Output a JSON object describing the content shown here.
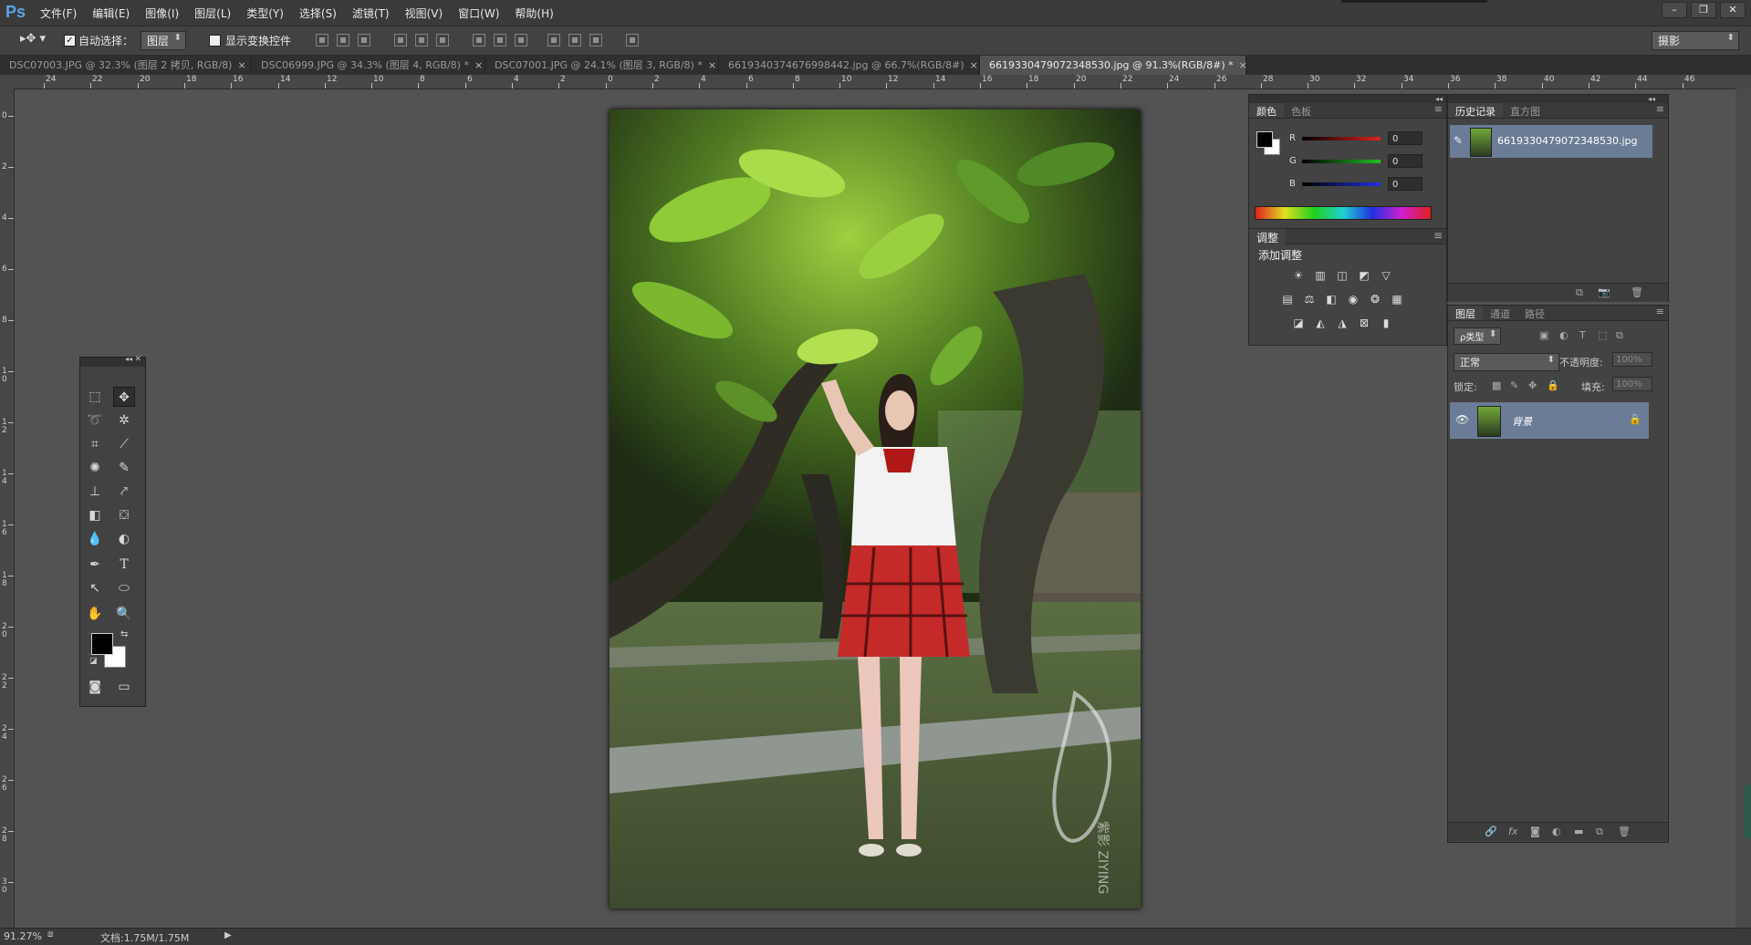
{
  "app": {
    "logo": "Ps"
  },
  "menu": [
    "文件(F)",
    "编辑(E)",
    "图像(I)",
    "图层(L)",
    "类型(Y)",
    "选择(S)",
    "滤镜(T)",
    "视图(V)",
    "窗口(W)",
    "帮助(H)"
  ],
  "window_controls": {
    "minimize": "–",
    "restore": "❐",
    "close": "✕"
  },
  "options": {
    "auto_select_label": "自动选择：",
    "auto_select_checked": true,
    "target_value": "图层",
    "show_transform_label": "显示变换控件",
    "show_transform_checked": false,
    "workspace": "摄影"
  },
  "tabs": [
    {
      "label": "DSC07003.JPG @ 32.3% (图层 2 拷贝, RGB/8)",
      "active": false
    },
    {
      "label": "DSC06999.JPG @ 34.3% (图层 4, RGB/8) *",
      "active": false
    },
    {
      "label": "DSC07001.JPG @ 24.1% (图层 3, RGB/8) *",
      "active": false
    },
    {
      "label": "6619340374676998442.jpg @ 66.7%(RGB/8#)",
      "active": false
    },
    {
      "label": "6619330479072348530.jpg @ 91.3%(RGB/8#) *",
      "active": true
    }
  ],
  "tab_close": "×",
  "ruler_top_labels": [
    "24",
    "22",
    "20",
    "18",
    "16",
    "14",
    "12",
    "10",
    "8",
    "6",
    "4",
    "2",
    "0",
    "2",
    "4",
    "6",
    "8",
    "10",
    "12",
    "14",
    "16",
    "18",
    "20",
    "22",
    "24",
    "26",
    "28",
    "30",
    "32",
    "34",
    "36",
    "38",
    "40",
    "42",
    "44",
    "46"
  ],
  "ruler_left_labels": [
    "0",
    "2",
    "4",
    "6",
    "8",
    "1\n0",
    "1\n2",
    "1\n4",
    "1\n6",
    "1\n8",
    "2\n0",
    "2\n2",
    "2\n4",
    "2\n6",
    "2\n8",
    "3\n0",
    "3\n2"
  ],
  "color_panel": {
    "tabs": [
      "颜色",
      "色板"
    ],
    "channels": [
      {
        "label": "R",
        "value": "0",
        "color": "#d02020"
      },
      {
        "label": "G",
        "value": "0",
        "color": "#20b020"
      },
      {
        "label": "B",
        "value": "0",
        "color": "#2030d0"
      }
    ],
    "foreground": "#000000",
    "background": "#ffffff"
  },
  "adjust_panel": {
    "title": "调整",
    "subtitle": "添加调整"
  },
  "history_panel": {
    "tabs": [
      "历史记录",
      "直方图"
    ],
    "item": "6619330479072348530.jpg"
  },
  "layers_panel": {
    "tabs": [
      "图层",
      "通道",
      "路径"
    ],
    "filter_label": "ρ类型",
    "blend_mode": "正常",
    "opacity_label": "不透明度:",
    "opacity_value": "100%",
    "lock_label": "锁定:",
    "fill_label": "填充:",
    "fill_value": "100%",
    "layer_name": "背景"
  },
  "status": {
    "zoom": "91.27%",
    "doc": "文档:1.75M/1.75M"
  },
  "photo_watermark": {
    "vertical_text": "紫影 ZIYING"
  }
}
